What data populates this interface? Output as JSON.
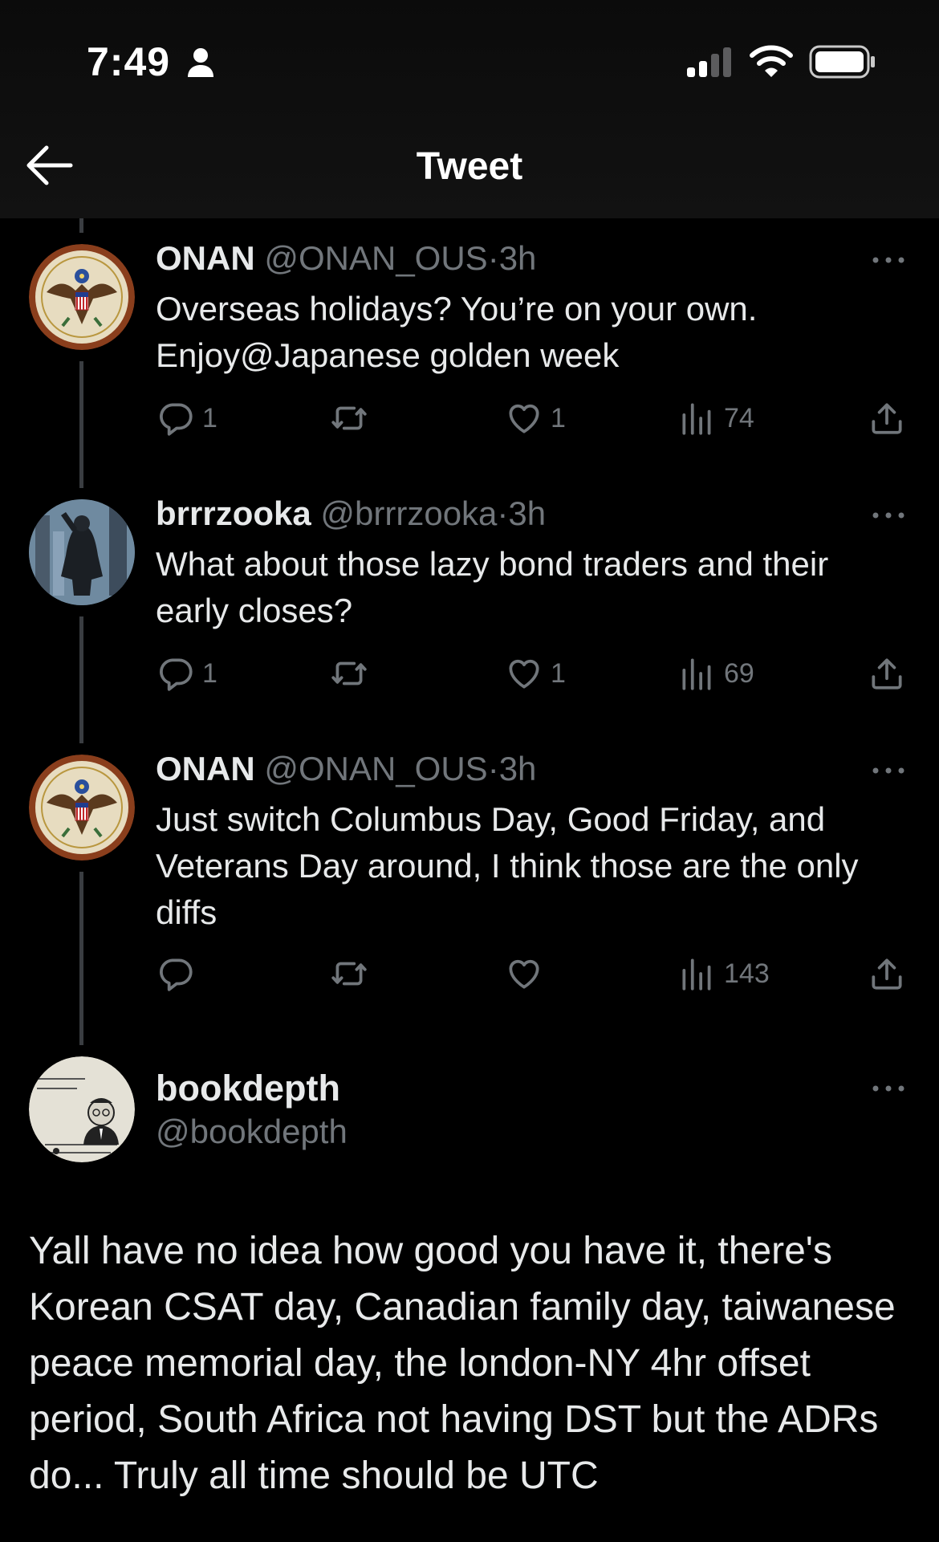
{
  "status_bar": {
    "time": "7:49"
  },
  "header": {
    "title": "Tweet"
  },
  "replies": [
    {
      "name": "ONAN",
      "handle": "@ONAN_OUS",
      "time": "3h",
      "text": "Overseas holidays? You’re on your own. Enjoy@Japanese golden week",
      "replies_count": "1",
      "retweets_count": "",
      "likes_count": "1",
      "views_count": "74"
    },
    {
      "name": "brrrzooka",
      "handle": "@brrrzooka",
      "time": "3h",
      "text": "What about those lazy bond traders and their early closes?",
      "replies_count": "1",
      "retweets_count": "",
      "likes_count": "1",
      "views_count": "69"
    },
    {
      "name": "ONAN",
      "handle": "@ONAN_OUS",
      "time": "3h",
      "text": "Just switch Columbus Day, Good Friday, and Veterans Day around, I think those are the only diffs",
      "replies_count": "",
      "retweets_count": "",
      "likes_count": "",
      "views_count": "143"
    }
  ],
  "main_tweet": {
    "name": "bookdepth",
    "handle": "@bookdepth",
    "text": "Yall have no idea how good you have it, there's Korean CSAT day, Canadian family day, taiwanese peace memorial day, the london-NY 4hr offset period, South Africa not having DST but the ADRs do... Truly all time should be UTC"
  },
  "icons": [
    "person-icon",
    "signal-icon",
    "wifi-icon",
    "battery-icon",
    "back-arrow-icon",
    "more-icon",
    "reply-icon",
    "retweet-icon",
    "like-icon",
    "views-icon",
    "share-icon"
  ],
  "colors": {
    "background": "#000000",
    "text": "#e7e9ea",
    "muted": "#71767b",
    "thread_line": "#3a3d41"
  }
}
